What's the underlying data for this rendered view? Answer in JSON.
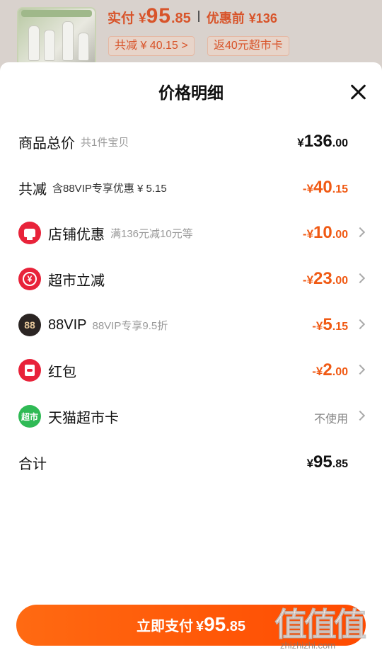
{
  "product_strip": {
    "pay_label": "实付",
    "currency": "¥",
    "price_int": "95",
    "price_dec": ".85",
    "before_label": "优惠前",
    "before_price": "¥136",
    "chip_total_reduce": "共减 ¥ 40.15 >",
    "chip_card": "返40元超市卡"
  },
  "sheet": {
    "title": "价格明细",
    "goods_total": {
      "label": "商品总价",
      "sub": "共1件宝贝",
      "currency": "¥",
      "int": "136",
      "dec": ".00"
    },
    "total_reduce": {
      "label": "共减",
      "sub": "含88VIP专享优惠 ¥ 5.15",
      "currency": "-¥",
      "int": "40",
      "dec": ".15"
    },
    "items": [
      {
        "label": "店铺优惠",
        "sub": "满136元减10元等",
        "currency": "-¥",
        "int": "10",
        "dec": ".00",
        "icon": "shop-icon"
      },
      {
        "label": "超市立减",
        "sub": "",
        "currency": "-¥",
        "int": "23",
        "dec": ".00",
        "icon": "yen-icon"
      },
      {
        "label": "88VIP",
        "sub": "88VIP专享9.5折",
        "currency": "-¥",
        "int": "5",
        "dec": ".15",
        "icon": "88vip-icon",
        "icon_text": "88"
      },
      {
        "label": "红包",
        "sub": "",
        "currency": "-¥",
        "int": "2",
        "dec": ".00",
        "icon": "red-packet-icon"
      },
      {
        "label": "天猫超市卡",
        "sub": "",
        "value_text": "不使用",
        "icon": "tmall-card-icon",
        "icon_text": "超市"
      }
    ],
    "total": {
      "label": "合计",
      "currency": "¥",
      "int": "95",
      "dec": ".85"
    },
    "pay_button": {
      "text": "立即支付",
      "currency": "¥",
      "int": "95",
      "dec": ".85"
    }
  },
  "watermark": {
    "big": "值值值",
    "small": "zhizhizhi.com"
  },
  "colors": {
    "accent": "#f05a14",
    "brand_red": "#e8233a",
    "button": "#ff5a0a"
  }
}
